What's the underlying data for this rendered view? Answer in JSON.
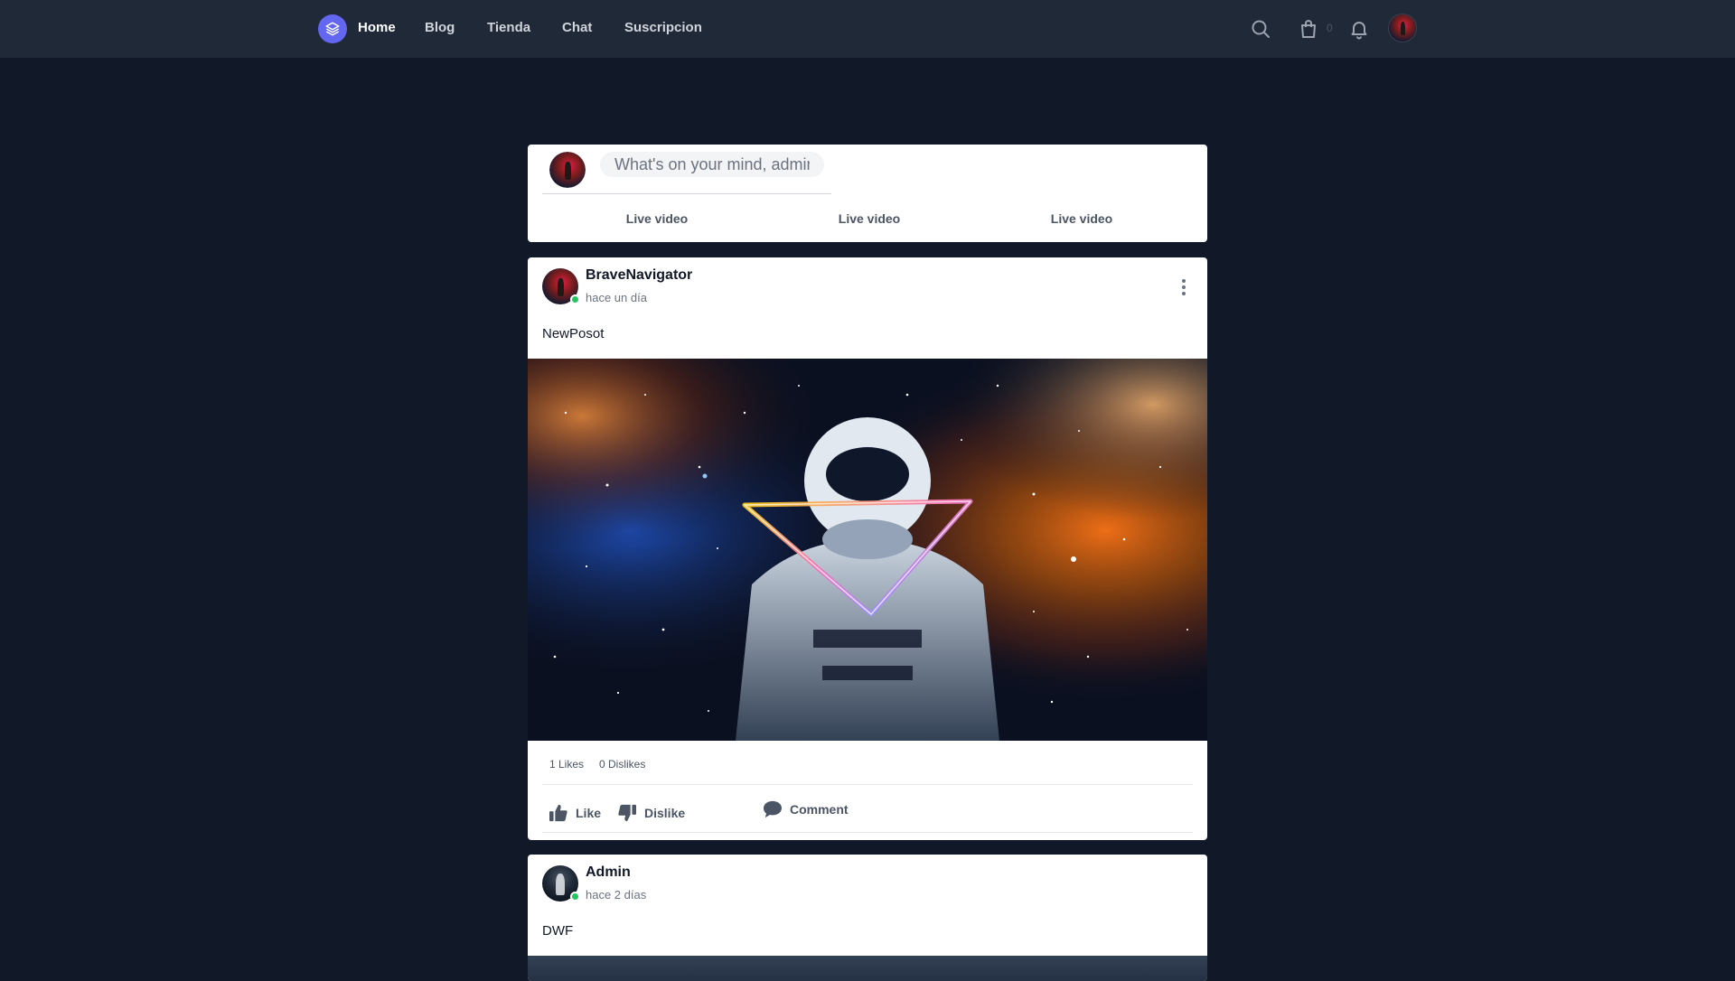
{
  "nav": {
    "links": [
      "Home",
      "Blog",
      "Tienda",
      "Chat",
      "Suscripcion"
    ],
    "cart_count": "0",
    "icons": [
      "layers-icon",
      "search-icon",
      "shopping-bag-icon",
      "bell-icon"
    ]
  },
  "composer": {
    "placeholder": "What's on your mind, admin?",
    "actions": [
      "Live video",
      "Live video",
      "Live video"
    ]
  },
  "posts": [
    {
      "author": "BraveNavigator",
      "time": "hace un día",
      "text": "NewPosot",
      "likes": "1 Likes",
      "dislikes": "0 Dislikes",
      "actions": {
        "like": "Like",
        "dislike": "Dislike",
        "comment": "Comment"
      }
    },
    {
      "author": "Admin",
      "time": "hace 2 días",
      "text": "DWF"
    }
  ],
  "colors": {
    "page_bg": "#111827",
    "nav_bg": "#1f2937",
    "accent": "#6366f1",
    "online": "#22c55e"
  }
}
